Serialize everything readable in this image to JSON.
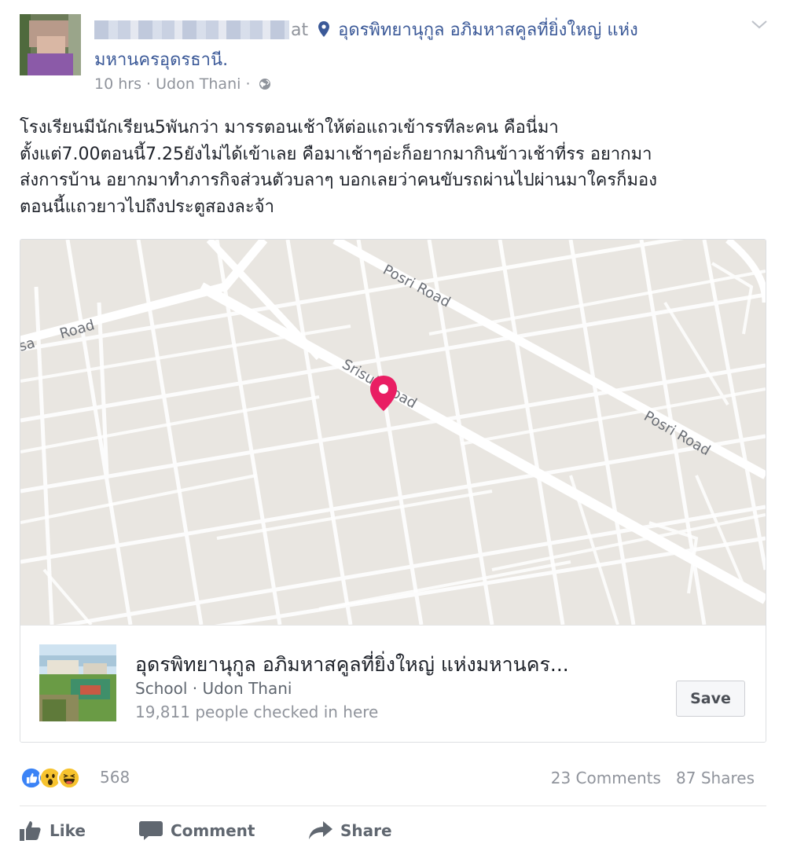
{
  "header": {
    "at_text": "at",
    "location_line1": "อุดรพิทยานุกูล อภิมหาสคูลที่ยิ่งใหญ่ แห่ง",
    "location_line2": "มหานครอุดรธานี.",
    "time": "10 hrs",
    "place": "Udon Thani",
    "separator": "·"
  },
  "post": {
    "lines": [
      "โรงเรียนมีนักเรียน5พันกว่า มารรตอนเช้าให้ต่อแถวเข้ารรทีละคน คือนี่มา",
      "ตั้งแต่7.00ตอนนี้7.25ยังไม่ได้เข้าเลย คือมาเช้าๆอ่ะก็อยากมากินข้าวเช้าที่รร อยากมา",
      "ส่งการบ้าน อยากมาทำภารกิจส่วนตัวบลาๆ บอกเลยว่าคนขับรถผ่านไปผ่านมาใครก็มอง",
      "ตอนนี้แถวยาวไปถึงประตูสองละจ้า"
    ]
  },
  "map": {
    "labels": {
      "posri_road_top": "Posri Road",
      "srisuk_road": "Srisuk Road",
      "posri_road_right": "Posri Road",
      "road_left": "Road",
      "road_left_partial": "sa"
    },
    "pin_color": "#e91e63"
  },
  "place_card": {
    "name": "อุดรพิทยานุกูล อภิมหาสคูลที่ยิ่งใหญ่ แห่งมหานคร...",
    "category": "School · Udon Thani",
    "checkins": "19,811 people checked in here",
    "save_label": "Save"
  },
  "reactions": {
    "types": [
      "like-icon",
      "wow-icon",
      "haha-icon"
    ],
    "count": "568",
    "comments": "23 Comments",
    "shares": "87 Shares"
  },
  "actions": {
    "like": "Like",
    "comment": "Comment",
    "share": "Share"
  },
  "colors": {
    "link_blue": "#3b5998",
    "meta_gray": "#90949c",
    "like_blue": "#3b83f6",
    "reaction_yellow": "#f7c32e"
  }
}
